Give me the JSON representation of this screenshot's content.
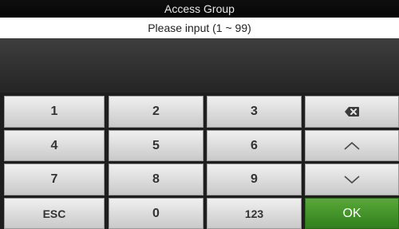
{
  "header": {
    "title": "Access Group"
  },
  "prompt": {
    "text": "Please input (1 ~ 99)"
  },
  "input": {
    "value": ""
  },
  "keypad": {
    "k1": "1",
    "k2": "2",
    "k3": "3",
    "k4": "4",
    "k5": "5",
    "k6": "6",
    "k7": "7",
    "k8": "8",
    "k9": "9",
    "esc": "ESC",
    "k0": "0",
    "mode": "123",
    "ok": "OK",
    "icons": {
      "backspace": "backspace-icon",
      "up": "chevron-up-icon",
      "down": "chevron-down-icon"
    }
  },
  "colors": {
    "ok_key": "#3f9026",
    "key_face": "#dcdcdc",
    "title_bg": "#0a0a0a",
    "hint_bg": "#ffffff"
  }
}
